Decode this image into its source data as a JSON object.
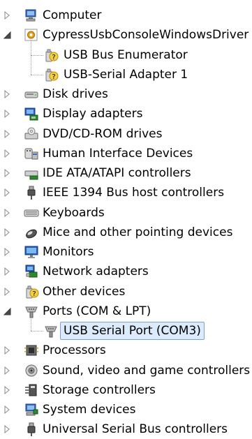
{
  "tree": [
    {
      "label": "Computer",
      "icon": "computer-icon",
      "expander": "collapsed"
    },
    {
      "label": "CypressUsbConsoleWindowsDriver",
      "icon": "driver-gear-icon",
      "expander": "expanded",
      "children": [
        {
          "label": "USB Bus Enumerator",
          "icon": "unknown-device-icon"
        },
        {
          "label": "USB-Serial Adapter 1",
          "icon": "unknown-device-icon"
        }
      ]
    },
    {
      "label": "Disk drives",
      "icon": "disk-drive-icon",
      "expander": "collapsed"
    },
    {
      "label": "Display adapters",
      "icon": "display-adapter-icon",
      "expander": "collapsed"
    },
    {
      "label": "DVD/CD-ROM drives",
      "icon": "dvd-drive-icon",
      "expander": "collapsed"
    },
    {
      "label": "Human Interface Devices",
      "icon": "hid-icon",
      "expander": "collapsed"
    },
    {
      "label": "IDE ATA/ATAPI controllers",
      "icon": "ide-controller-icon",
      "expander": "collapsed"
    },
    {
      "label": "IEEE 1394 Bus host controllers",
      "icon": "ieee1394-icon",
      "expander": "collapsed"
    },
    {
      "label": "Keyboards",
      "icon": "keyboard-icon",
      "expander": "collapsed"
    },
    {
      "label": "Mice and other pointing devices",
      "icon": "mouse-icon",
      "expander": "collapsed"
    },
    {
      "label": "Monitors",
      "icon": "monitor-icon",
      "expander": "collapsed"
    },
    {
      "label": "Network adapters",
      "icon": "network-adapter-icon",
      "expander": "collapsed"
    },
    {
      "label": "Other devices",
      "icon": "unknown-device-icon",
      "expander": "collapsed"
    },
    {
      "label": "Ports (COM & LPT)",
      "icon": "port-icon",
      "expander": "expanded",
      "children": [
        {
          "label": "USB Serial Port (COM3)",
          "icon": "port-icon",
          "selected": true
        }
      ]
    },
    {
      "label": "Processors",
      "icon": "processor-icon",
      "expander": "collapsed"
    },
    {
      "label": "Sound, video and game controllers",
      "icon": "sound-icon",
      "expander": "collapsed"
    },
    {
      "label": "Storage controllers",
      "icon": "storage-controller-icon",
      "expander": "collapsed"
    },
    {
      "label": "System devices",
      "icon": "system-devices-icon",
      "expander": "collapsed"
    },
    {
      "label": "Universal Serial Bus controllers",
      "icon": "usb-controller-icon",
      "expander": "collapsed"
    }
  ],
  "colors": {
    "selection_fill": "#dcebfc",
    "selection_border": "#7da2ce"
  }
}
